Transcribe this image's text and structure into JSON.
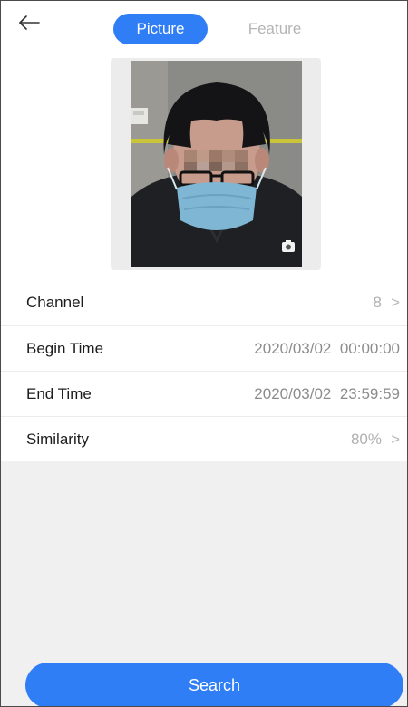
{
  "header": {
    "back_icon": "arrow-left-icon",
    "tabs": [
      {
        "label": "Picture",
        "active": true
      },
      {
        "label": "Feature",
        "active": false
      }
    ]
  },
  "photo": {
    "camera_icon": "camera-icon"
  },
  "filters": [
    {
      "label": "Channel",
      "value": "8",
      "has_chevron": true
    },
    {
      "label": "Begin Time",
      "value": "2020/03/02  00:00:00",
      "has_chevron": false
    },
    {
      "label": "End Time",
      "value": "2020/03/02  23:59:59",
      "has_chevron": false
    },
    {
      "label": "Similarity",
      "value": "80%",
      "has_chevron": true
    }
  ],
  "search_button": {
    "label": "Search"
  },
  "colors": {
    "accent": "#2f7ef6",
    "background": "#f0f0f0",
    "label_text": "#1c1c1c",
    "muted_text": "#b0b0b0"
  }
}
